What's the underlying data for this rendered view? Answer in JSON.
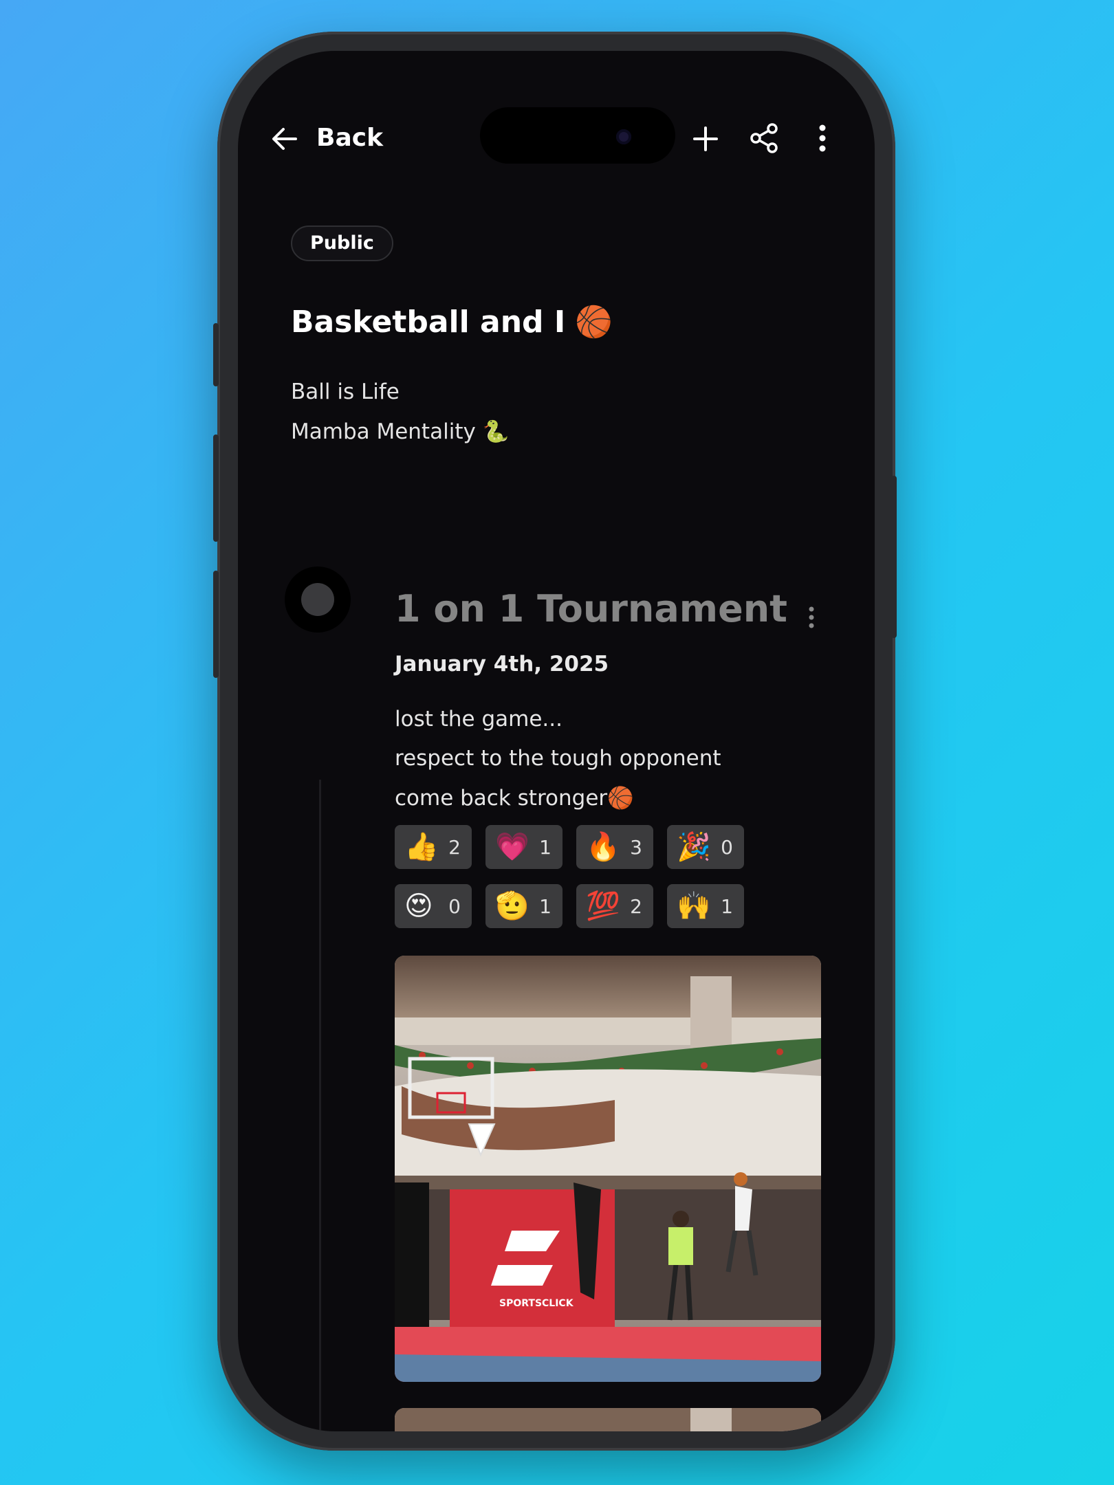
{
  "header": {
    "back_label": "Back",
    "icons": [
      "back-arrow-icon",
      "plus-icon",
      "share-icon",
      "more-vertical-icon"
    ]
  },
  "journal": {
    "visibility": "Public",
    "title": "Basketball and I",
    "title_emoji": "🏀",
    "description_lines": [
      "Ball is Life",
      "Mamba Mentality 🐍"
    ]
  },
  "entry": {
    "title": "1 on 1 Tournament",
    "date": "January 4th, 2025",
    "text_lines": [
      "lost the game...",
      "respect to the tough opponent",
      "come back stronger🏀"
    ],
    "reactions": [
      {
        "emoji": "👍",
        "count": "2"
      },
      {
        "emoji": "💗",
        "count": "1"
      },
      {
        "emoji": "🔥",
        "count": "3"
      },
      {
        "emoji": "🎉",
        "count": "0"
      },
      {
        "emoji": "😍",
        "count": "0"
      },
      {
        "emoji": "🫡",
        "count": "1"
      },
      {
        "emoji": "💯",
        "count": "2"
      },
      {
        "emoji": "🙌",
        "count": "1"
      }
    ],
    "photos": [
      {
        "description_icon": "basketball-court-photo",
        "brand_text": "SPORTSCLICK"
      },
      {
        "description_icon": "mall-photo"
      }
    ]
  },
  "colors": {
    "background_top": "#46a8f5",
    "background_bottom": "#17d2e8",
    "screen": "#0b0a0d",
    "chip": "#3b3b3d",
    "entry_title": "#858585"
  }
}
